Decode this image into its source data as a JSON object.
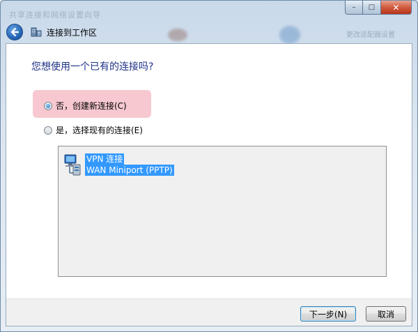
{
  "window": {
    "ghost_title": "共享连接和网络设置向导",
    "ghost_right": "更改适配器设置",
    "controls": {
      "minimize": "–",
      "maximize": "□",
      "close": "✕"
    }
  },
  "nav": {
    "title": "连接到工作区"
  },
  "main": {
    "heading": "您想使用一个已有的连接吗?",
    "options": [
      {
        "label": "否，创建新连接(C)",
        "checked": true
      },
      {
        "label": "是，选择现有的连接(E)",
        "checked": false
      }
    ],
    "connection": {
      "name": "VPN 连接",
      "device": "WAN Miniport (PPTP)"
    }
  },
  "footer": {
    "next_label": "下一步(N)",
    "cancel_label": "取消"
  },
  "colors": {
    "heading": "#1e3287",
    "selection": "#3399ff",
    "highlight": "#f7c8cf"
  }
}
